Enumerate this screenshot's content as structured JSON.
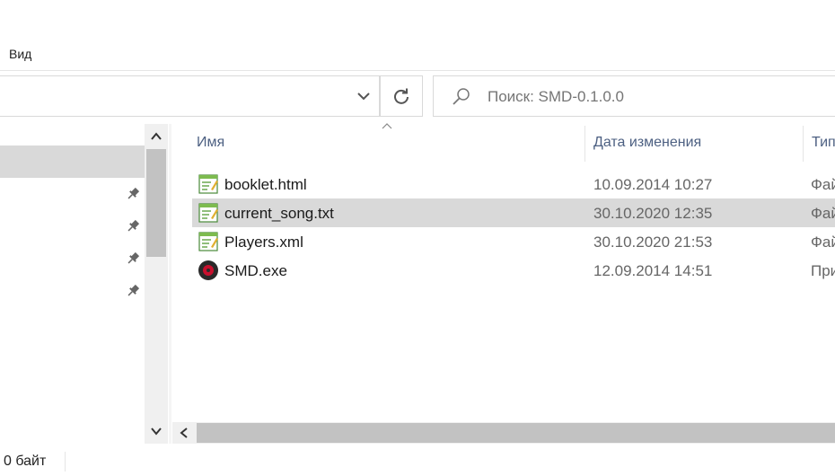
{
  "ribbon": {
    "view_tab": "Вид"
  },
  "search": {
    "placeholder": "Поиск: SMD-0.1.0.0"
  },
  "columns": {
    "name": "Имя",
    "modified": "Дата изменения",
    "type": "Тип"
  },
  "files": [
    {
      "name": "booklet.html",
      "modified": "10.09.2014 10:27",
      "type": "Фай",
      "icon": "document-icon",
      "selected": false
    },
    {
      "name": "current_song.txt",
      "modified": "30.10.2020 12:35",
      "type": "Фай",
      "icon": "document-icon",
      "selected": true
    },
    {
      "name": "Players.xml",
      "modified": "30.10.2020 21:53",
      "type": "Фай",
      "icon": "document-icon",
      "selected": false
    },
    {
      "name": "SMD.exe",
      "modified": "12.09.2014 14:51",
      "type": "При",
      "icon": "disc-icon",
      "selected": false
    }
  ],
  "status": {
    "size": "0 байт"
  },
  "colors": {
    "selection": "#d9d9d9",
    "header_text": "#4d6082",
    "scroll_thumb": "#c2c2c2"
  }
}
